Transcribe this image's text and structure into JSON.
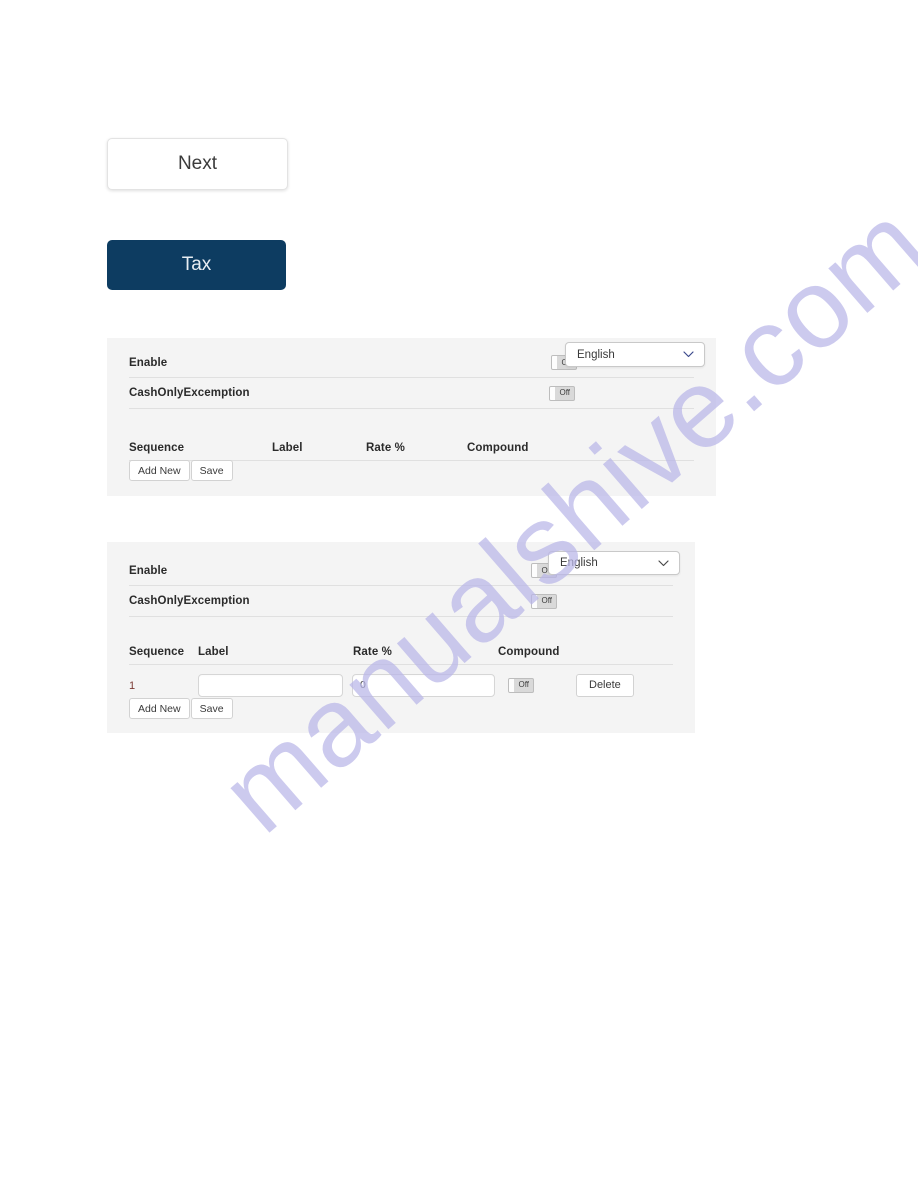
{
  "watermark": {
    "text": "manualshive.com",
    "color": "#b9b6e8"
  },
  "nav": {
    "next_label": "Next",
    "tax_label": "Tax",
    "tax_color": "#0d3c61"
  },
  "panels": [
    {
      "id": "panel-1",
      "settings": [
        {
          "label": "Enable",
          "toggle": "Off"
        },
        {
          "label": "CashOnlyExcemption",
          "toggle": "Off"
        }
      ],
      "language": {
        "value": "English",
        "chevron": "chevron-down-icon"
      },
      "table": {
        "columns": [
          "Sequence",
          "Label",
          "Rate %",
          "Compound"
        ],
        "rows": []
      },
      "actions": {
        "add_new": "Add New",
        "save": "Save"
      }
    },
    {
      "id": "panel-2",
      "settings": [
        {
          "label": "Enable",
          "toggle": "Off"
        },
        {
          "label": "CashOnlyExcemption",
          "toggle": "Off"
        }
      ],
      "language": {
        "value": "English",
        "chevron": "chevron-down-icon"
      },
      "table": {
        "columns": [
          "Sequence",
          "Label",
          "Rate %",
          "Compound"
        ],
        "rows": [
          {
            "sequence": "1",
            "label_value": "",
            "rate_value": "0",
            "compound": "Off",
            "delete": "Delete"
          }
        ]
      },
      "actions": {
        "add_new": "Add New",
        "save": "Save"
      }
    }
  ]
}
